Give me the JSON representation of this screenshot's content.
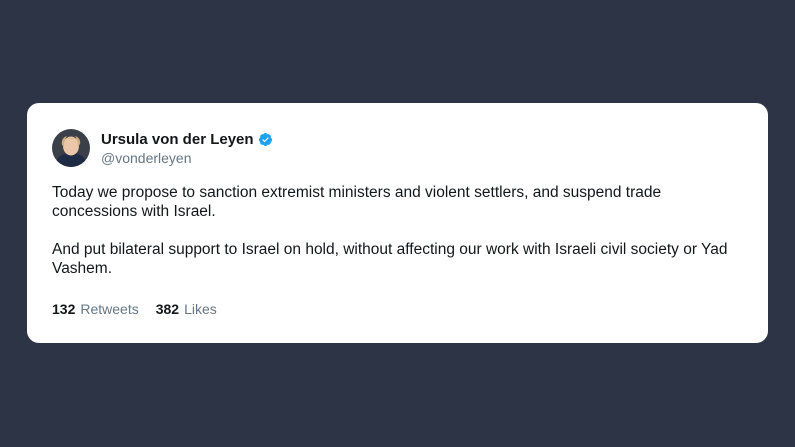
{
  "author": {
    "display_name": "Ursula von der Leyen",
    "handle": "@vonderleyen",
    "avatar_icon": "profile-photo",
    "verified_icon": "verified-badge-icon"
  },
  "tweet": {
    "paragraphs": [
      "Today we propose to sanction extremist ministers and violent settlers, and suspend trade concessions with Israel.",
      "And put bilateral support to Israel on hold, without affecting our work with Israeli civil society or Yad Vashem."
    ]
  },
  "stats": {
    "retweets_count": "132",
    "retweets_label": "Retweets",
    "likes_count": "382",
    "likes_label": "Likes"
  },
  "colors": {
    "background": "#2d3446",
    "card": "#ffffff",
    "verified": "#1da1f2",
    "muted_text": "#657786",
    "primary_text": "#14171a"
  }
}
